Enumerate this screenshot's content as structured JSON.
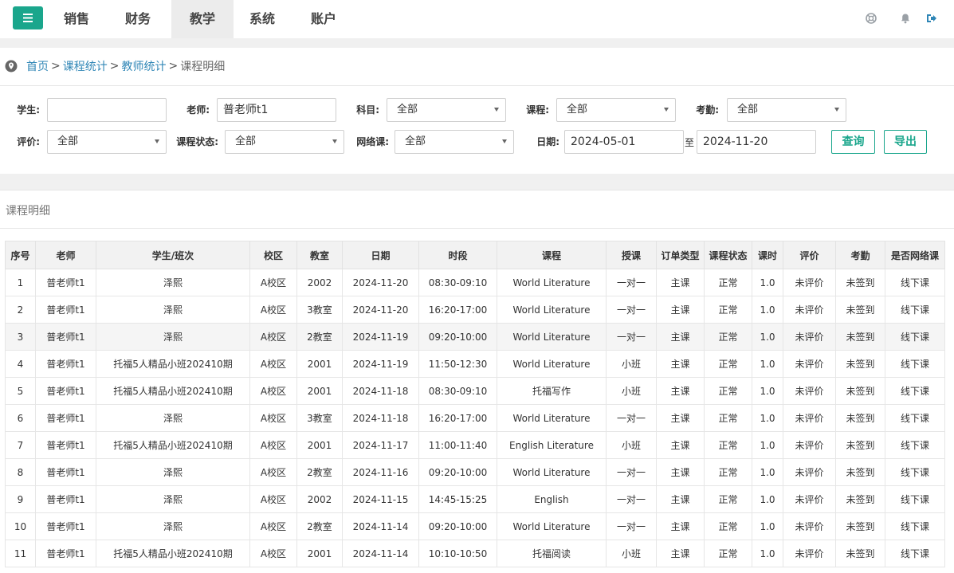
{
  "nav": {
    "items": [
      "销售",
      "财务",
      "教学",
      "系统",
      "账户"
    ],
    "active_index": 2
  },
  "top_icons": [
    "help-circle-icon",
    "bell-icon",
    "logout-icon"
  ],
  "breadcrumb": {
    "items": [
      "首页",
      "课程统计",
      "教师统计",
      "课程明细"
    ],
    "separator": ">"
  },
  "filters": {
    "student_label": "学生:",
    "student_value": "",
    "teacher_label": "老师:",
    "teacher_value": "普老师t1",
    "subject_label": "科目:",
    "subject_value": "全部",
    "course_label": "课程:",
    "course_value": "全部",
    "attendance_label": "考勤:",
    "attendance_value": "全部",
    "rating_label": "评价:",
    "rating_value": "全部",
    "status_label": "课程状态:",
    "status_value": "全部",
    "online_label": "网络课:",
    "online_value": "全部",
    "date_label": "日期:",
    "date_from": "2024-05-01",
    "date_sep": "至",
    "date_to": "2024-11-20",
    "query_button": "查询",
    "export_button": "导出"
  },
  "section_title": "课程明细",
  "table": {
    "columns": [
      "序号",
      "老师",
      "学生/班次",
      "校区",
      "教室",
      "日期",
      "时段",
      "课程",
      "授课",
      "订单类型",
      "课程状态",
      "课时",
      "评价",
      "考勤",
      "是否网络课"
    ],
    "rows": [
      [
        "1",
        "普老师t1",
        "泽熙",
        "A校区",
        "2002",
        "2024-11-20",
        "08:30-09:10",
        "World Literature",
        "一对一",
        "主课",
        "正常",
        "1.0",
        "未评价",
        "未签到",
        "线下课"
      ],
      [
        "2",
        "普老师t1",
        "泽熙",
        "A校区",
        "3教室",
        "2024-11-20",
        "16:20-17:00",
        "World Literature",
        "一对一",
        "主课",
        "正常",
        "1.0",
        "未评价",
        "未签到",
        "线下课"
      ],
      [
        "3",
        "普老师t1",
        "泽熙",
        "A校区",
        "2教室",
        "2024-11-19",
        "09:20-10:00",
        "World Literature",
        "一对一",
        "主课",
        "正常",
        "1.0",
        "未评价",
        "未签到",
        "线下课"
      ],
      [
        "4",
        "普老师t1",
        "托福5人精品小班202410期",
        "A校区",
        "2001",
        "2024-11-19",
        "11:50-12:30",
        "World Literature",
        "小班",
        "主课",
        "正常",
        "1.0",
        "未评价",
        "未签到",
        "线下课"
      ],
      [
        "5",
        "普老师t1",
        "托福5人精品小班202410期",
        "A校区",
        "2001",
        "2024-11-18",
        "08:30-09:10",
        "托福写作",
        "小班",
        "主课",
        "正常",
        "1.0",
        "未评价",
        "未签到",
        "线下课"
      ],
      [
        "6",
        "普老师t1",
        "泽熙",
        "A校区",
        "3教室",
        "2024-11-18",
        "16:20-17:00",
        "World Literature",
        "一对一",
        "主课",
        "正常",
        "1.0",
        "未评价",
        "未签到",
        "线下课"
      ],
      [
        "7",
        "普老师t1",
        "托福5人精品小班202410期",
        "A校区",
        "2001",
        "2024-11-17",
        "11:00-11:40",
        "English Literature",
        "小班",
        "主课",
        "正常",
        "1.0",
        "未评价",
        "未签到",
        "线下课"
      ],
      [
        "8",
        "普老师t1",
        "泽熙",
        "A校区",
        "2教室",
        "2024-11-16",
        "09:20-10:00",
        "World Literature",
        "一对一",
        "主课",
        "正常",
        "1.0",
        "未评价",
        "未签到",
        "线下课"
      ],
      [
        "9",
        "普老师t1",
        "泽熙",
        "A校区",
        "2002",
        "2024-11-15",
        "14:45-15:25",
        "English",
        "一对一",
        "主课",
        "正常",
        "1.0",
        "未评价",
        "未签到",
        "线下课"
      ],
      [
        "10",
        "普老师t1",
        "泽熙",
        "A校区",
        "2教室",
        "2024-11-14",
        "09:20-10:00",
        "World Literature",
        "一对一",
        "主课",
        "正常",
        "1.0",
        "未评价",
        "未签到",
        "线下课"
      ],
      [
        "11",
        "普老师t1",
        "托福5人精品小班202410期",
        "A校区",
        "2001",
        "2024-11-14",
        "10:10-10:50",
        "托福阅读",
        "小班",
        "主课",
        "正常",
        "1.0",
        "未评价",
        "未签到",
        "线下课"
      ]
    ],
    "highlighted_row_index": 2
  },
  "colors": {
    "accent": "#1aa68c",
    "link": "#2f86b6",
    "band": "#f0f0f0"
  }
}
